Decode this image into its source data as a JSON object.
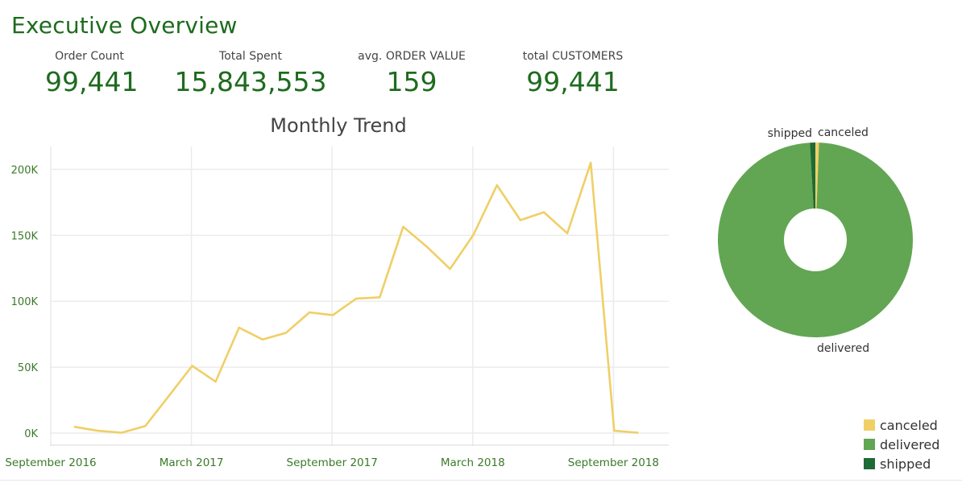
{
  "dashboard": {
    "title": "Executive Overview"
  },
  "kpis": [
    {
      "label": "Order Count",
      "value": "99,441"
    },
    {
      "label": "Total Spent",
      "value": "15,843,553"
    },
    {
      "label": "avg. ORDER VALUE",
      "value": "159"
    },
    {
      "label": "total CUSTOMERS",
      "value": "99,441"
    }
  ],
  "colors": {
    "title": "#1e6b1e",
    "line": "#f0cf66",
    "canceled": "#f0cf66",
    "delivered": "#62a653",
    "shipped": "#1e6b35",
    "grid": "#ececec",
    "axis_text": "#3a7a2a"
  },
  "chart_data": [
    {
      "type": "line",
      "title": "Monthly Trend",
      "xlabel": "",
      "ylabel": "",
      "x": [
        "2016-09",
        "2016-10",
        "2016-11",
        "2016-12",
        "2017-01",
        "2017-02",
        "2017-03",
        "2017-04",
        "2017-05",
        "2017-06",
        "2017-07",
        "2017-08",
        "2017-09",
        "2017-10",
        "2017-11",
        "2017-12",
        "2018-01",
        "2018-02",
        "2018-03",
        "2018-04",
        "2018-05",
        "2018-06",
        "2018-07",
        "2018-08",
        "2018-09",
        "2018-10"
      ],
      "x_tick_labels": [
        {
          "month": "2016-09",
          "label": "September 2016"
        },
        {
          "month": "2017-03",
          "label": "March 2017"
        },
        {
          "month": "2017-09",
          "label": "September 2017"
        },
        {
          "month": "2018-03",
          "label": "March 2018"
        },
        {
          "month": "2018-09",
          "label": "September 2018"
        }
      ],
      "series": [
        {
          "values": [
            4700,
            1700,
            300,
            5300,
            28000,
            51000,
            39000,
            80000,
            71000,
            76000,
            91500,
            89500,
            102000,
            103000,
            156500,
            141500,
            124500,
            150500,
            188000,
            161500,
            167500,
            151500,
            205000,
            1800,
            300,
            null
          ]
        }
      ],
      "ylim": [
        0,
        210000
      ],
      "y_ticks": [
        0,
        50000,
        100000,
        150000,
        200000
      ],
      "y_tick_labels": [
        "0K",
        "50K",
        "100K",
        "150K",
        "200K"
      ],
      "grid": true
    },
    {
      "type": "pie",
      "title": "",
      "categories": [
        "canceled",
        "delivered",
        "shipped"
      ],
      "values": [
        0.6,
        98.5,
        0.9
      ],
      "slice_labels": [
        "canceled",
        "delivered",
        "shipped"
      ],
      "legend": {
        "position": "bottom-right",
        "items": [
          "canceled",
          "delivered",
          "shipped"
        ]
      }
    }
  ]
}
